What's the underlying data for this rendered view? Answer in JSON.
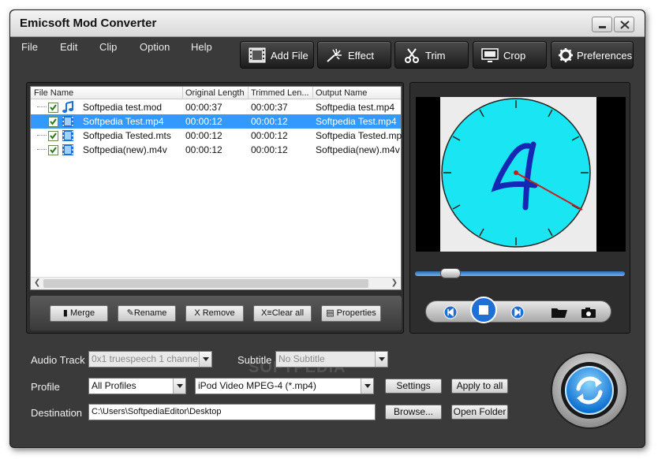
{
  "window": {
    "title": "Emicsoft Mod Converter"
  },
  "menu": [
    {
      "label": "File"
    },
    {
      "label": "Edit"
    },
    {
      "label": "Clip"
    },
    {
      "label": "Option"
    },
    {
      "label": "Help"
    }
  ],
  "toolbar": [
    {
      "label": "Add File",
      "icon": "film-add-icon"
    },
    {
      "label": "Effect",
      "icon": "magic-wand-icon"
    },
    {
      "label": "Trim",
      "icon": "scissors-icon"
    },
    {
      "label": "Crop",
      "icon": "monitor-crop-icon"
    },
    {
      "label": "Preferences",
      "icon": "gear-icon"
    }
  ],
  "file_list": {
    "columns": [
      "File Name",
      "Original Length",
      "Trimmed Len...",
      "Output Name"
    ],
    "rows": [
      {
        "name": "Softpedia test.mod",
        "original": "00:00:37",
        "trimmed": "00:00:37",
        "output": "Softpedia test.mp4",
        "icon": "audio-note-icon",
        "selected": false
      },
      {
        "name": "Softpedia Test.mp4",
        "original": "00:00:12",
        "trimmed": "00:00:12",
        "output": "Softpedia Test.mp4",
        "icon": "film-icon",
        "selected": true
      },
      {
        "name": "Softpedia Tested.mts",
        "original": "00:00:12",
        "trimmed": "00:00:12",
        "output": "Softpedia Tested.mp4",
        "icon": "film-icon",
        "selected": false
      },
      {
        "name": "Softpedia(new).m4v",
        "original": "00:00:12",
        "trimmed": "00:00:12",
        "output": "Softpedia(new).m4v",
        "icon": "film-icon",
        "selected": false
      }
    ]
  },
  "actions": {
    "merge": "Merge",
    "rename": "Rename",
    "remove": "Remove",
    "clear_all": "Clear all",
    "properties": "Properties"
  },
  "preview": {
    "seek_position": 0.12
  },
  "settings": {
    "audio_track_label": "Audio Track",
    "audio_track_value": "0x1 truespeech 1 channe",
    "subtitle_label": "Subtitle",
    "subtitle_value": "No Subtitle",
    "profile_label": "Profile",
    "profile_category": "All Profiles",
    "profile_value": "iPod Video MPEG-4 (*.mp4)",
    "destination_label": "Destination",
    "destination_value": "C:\\Users\\SoftpediaEditor\\Desktop",
    "settings_button": "Settings",
    "apply_all_button": "Apply to all",
    "browse_button": "Browse...",
    "open_folder_button": "Open Folder"
  },
  "watermark": "SOFTPEDIA",
  "colors": {
    "selection": "#3399ff",
    "clock_face": "#19e6f2",
    "digit": "#1428b4",
    "hand": "#c81e1e"
  }
}
